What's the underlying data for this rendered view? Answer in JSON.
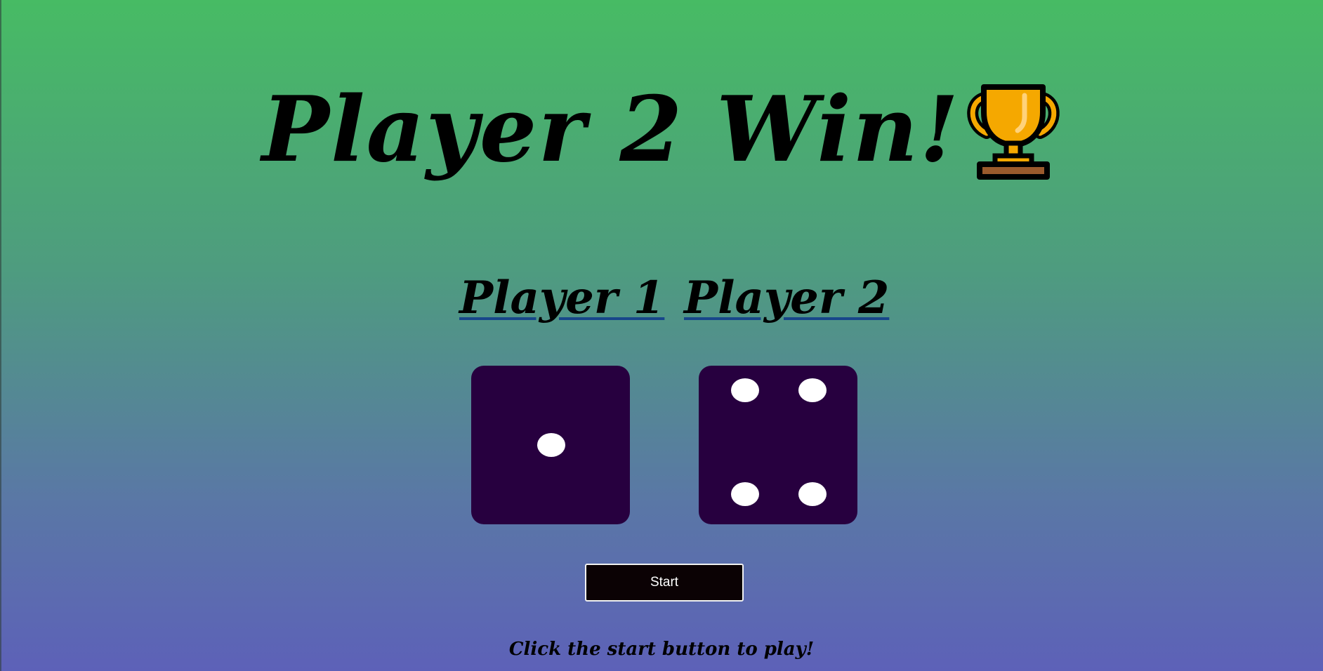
{
  "game": {
    "title": "Player 2 Win!",
    "title_icon": "trophy-icon",
    "players": [
      {
        "label": "Player 1",
        "die_value": 1
      },
      {
        "label": "Player 2",
        "die_value": 4
      }
    ],
    "start_button_label": "Start",
    "hint": "Click the start button to play!"
  },
  "colors": {
    "die_face": "#27003f",
    "pip": "#ffffff",
    "button_bg": "#0b0204",
    "underline": "#17468a",
    "gradient_top": "#47bb64",
    "gradient_bottom": "#5d61b8"
  }
}
